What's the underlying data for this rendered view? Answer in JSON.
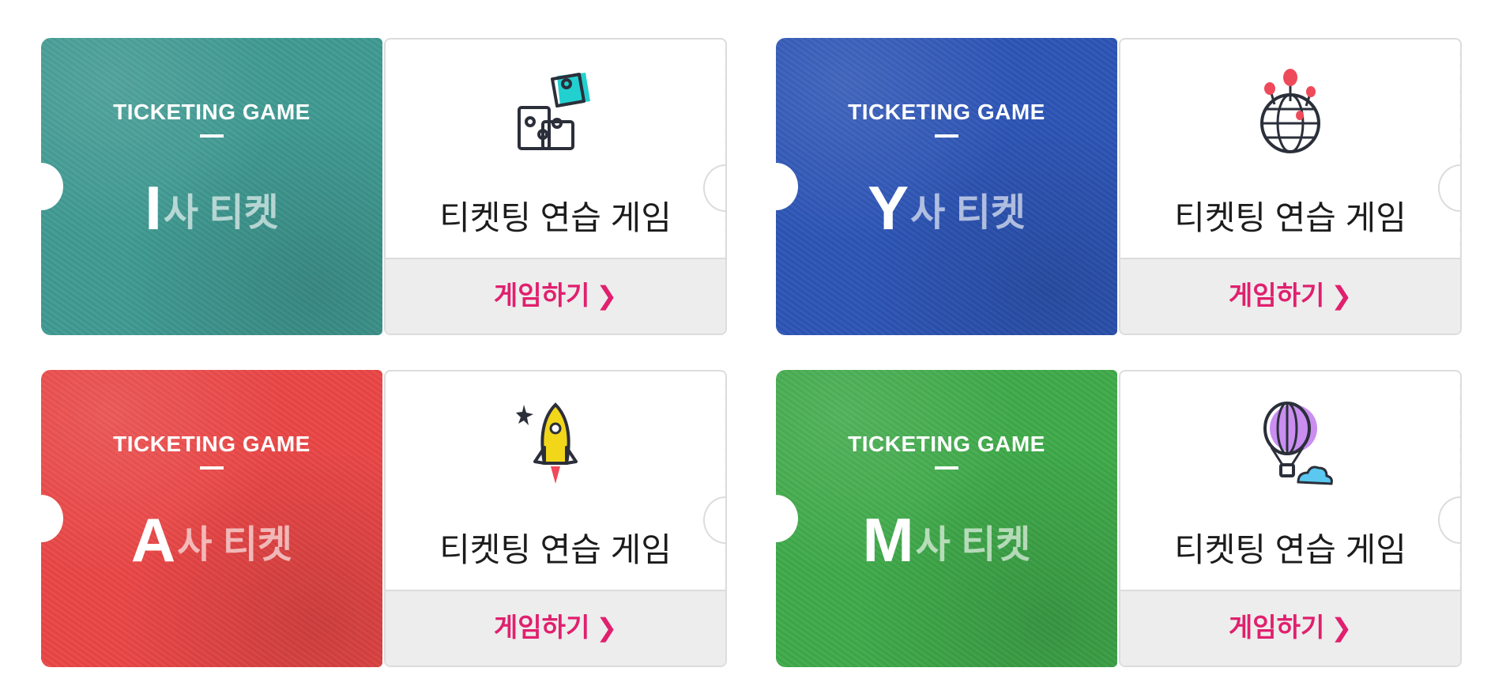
{
  "tickets": [
    {
      "label_top": "TICKETING GAME",
      "brand_letter": "I",
      "brand_suffix": "사 티켓",
      "title": "티켓팅 연습 게임",
      "action_label": "게임하기",
      "icon": "puzzle-icon",
      "color": "#3f9a92"
    },
    {
      "label_top": "TICKETING GAME",
      "brand_letter": "Y",
      "brand_suffix": "사 티켓",
      "title": "티켓팅 연습 게임",
      "action_label": "게임하기",
      "icon": "globe-balloons-icon",
      "color": "#2d55b6"
    },
    {
      "label_top": "TICKETING GAME",
      "brand_letter": "A",
      "brand_suffix": "사 티켓",
      "title": "티켓팅 연습 게임",
      "action_label": "게임하기",
      "icon": "rocket-icon",
      "color": "#ea4646"
    },
    {
      "label_top": "TICKETING GAME",
      "brand_letter": "M",
      "brand_suffix": "사 티켓",
      "title": "티켓팅 연습 게임",
      "action_label": "게임하기",
      "icon": "hot-air-balloon-icon",
      "color": "#3faa4a"
    }
  ],
  "accent_color": "#e0206e",
  "chevron_icon": "chevron-right-icon"
}
